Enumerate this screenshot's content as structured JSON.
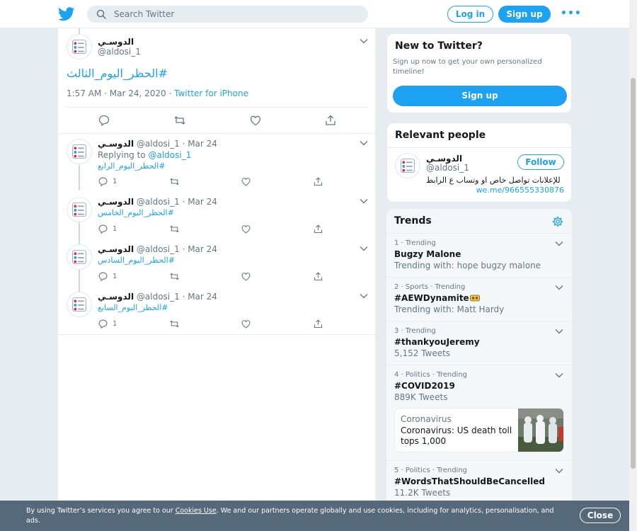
{
  "header": {
    "search_placeholder": "Search Twitter",
    "login_label": "Log in",
    "signup_label": "Sign up",
    "more_label": "•••"
  },
  "main_tweet": {
    "name": "الدوسـي",
    "handle": "@aldosi_1",
    "text": "#الحظر_اليوم_الثالث",
    "time": "1:57 AM · Mar 24, 2020",
    "separator": " · ",
    "source": "Twitter for iPhone"
  },
  "replies": [
    {
      "name": "الدوسـي",
      "handle_date": "@aldosi_1 · Mar 24",
      "replying_prefix": "Replying to ",
      "replying_to": "@aldosi_1",
      "text": "#الحظر_اليوم_الرابع",
      "reply_count": "1"
    },
    {
      "name": "الدوسـي",
      "handle_date": "@aldosi_1 · Mar 24",
      "text": "#الحظر_اليوم_الخامس",
      "reply_count": "1"
    },
    {
      "name": "الدوسـي",
      "handle_date": "@aldosi_1 · Mar 24",
      "text": "#الحظر_اليوم_السادس",
      "reply_count": "1"
    },
    {
      "name": "الدوسـي",
      "handle_date": "@aldosi_1 · Mar 24",
      "text": "#الحظر_اليوم_السابع",
      "reply_count": "1"
    }
  ],
  "new_to_twitter": {
    "title": "New to Twitter?",
    "description": "Sign up now to get your own personalized timeline!",
    "signup_label": "Sign up"
  },
  "relevant_people": {
    "title": "Relevant people",
    "name": "الدوسـي",
    "handle": "@aldosi_1",
    "follow_label": "Follow",
    "bio": "للإعلانات تواصل خاص او وتساب ع الرابط",
    "link": "we.me/966555330876"
  },
  "trends": {
    "title": "Trends",
    "items": [
      {
        "meta": "1 · Trending",
        "name": "Bugzy Malone",
        "sub": "Trending with: hope bugzy malone"
      },
      {
        "meta": "2 · Sports · Trending",
        "name": "#AEWDynamite",
        "sub": "Trending with: Matt Hardy"
      },
      {
        "meta": "3 · Trending",
        "name": "#thankyouJeremy",
        "sub": "5,152 Tweets"
      },
      {
        "meta": "4 · Politics · Trending",
        "name": "#COVID2019",
        "sub": "889K Tweets"
      },
      {
        "meta": "5 · Politics · Trending",
        "name": "#WordsThatShouldBeCancelled",
        "sub": "11.2K Tweets"
      }
    ],
    "news": {
      "category": "Coronavirus",
      "title": "Coronavirus: US death toll tops 1,000"
    }
  },
  "cookie_banner": {
    "text_before": "By using Twitter’s services you agree to our ",
    "link": "Cookies Use",
    "text_after": ". We and our partners operate globally and use cookies, including for analytics, personalisation, and ads.",
    "close_label": "Close"
  },
  "colors": {
    "brand": "#1da1f2",
    "background": "#e6ecf0",
    "muted": "#657786",
    "cookie_bar": "#56697a"
  }
}
